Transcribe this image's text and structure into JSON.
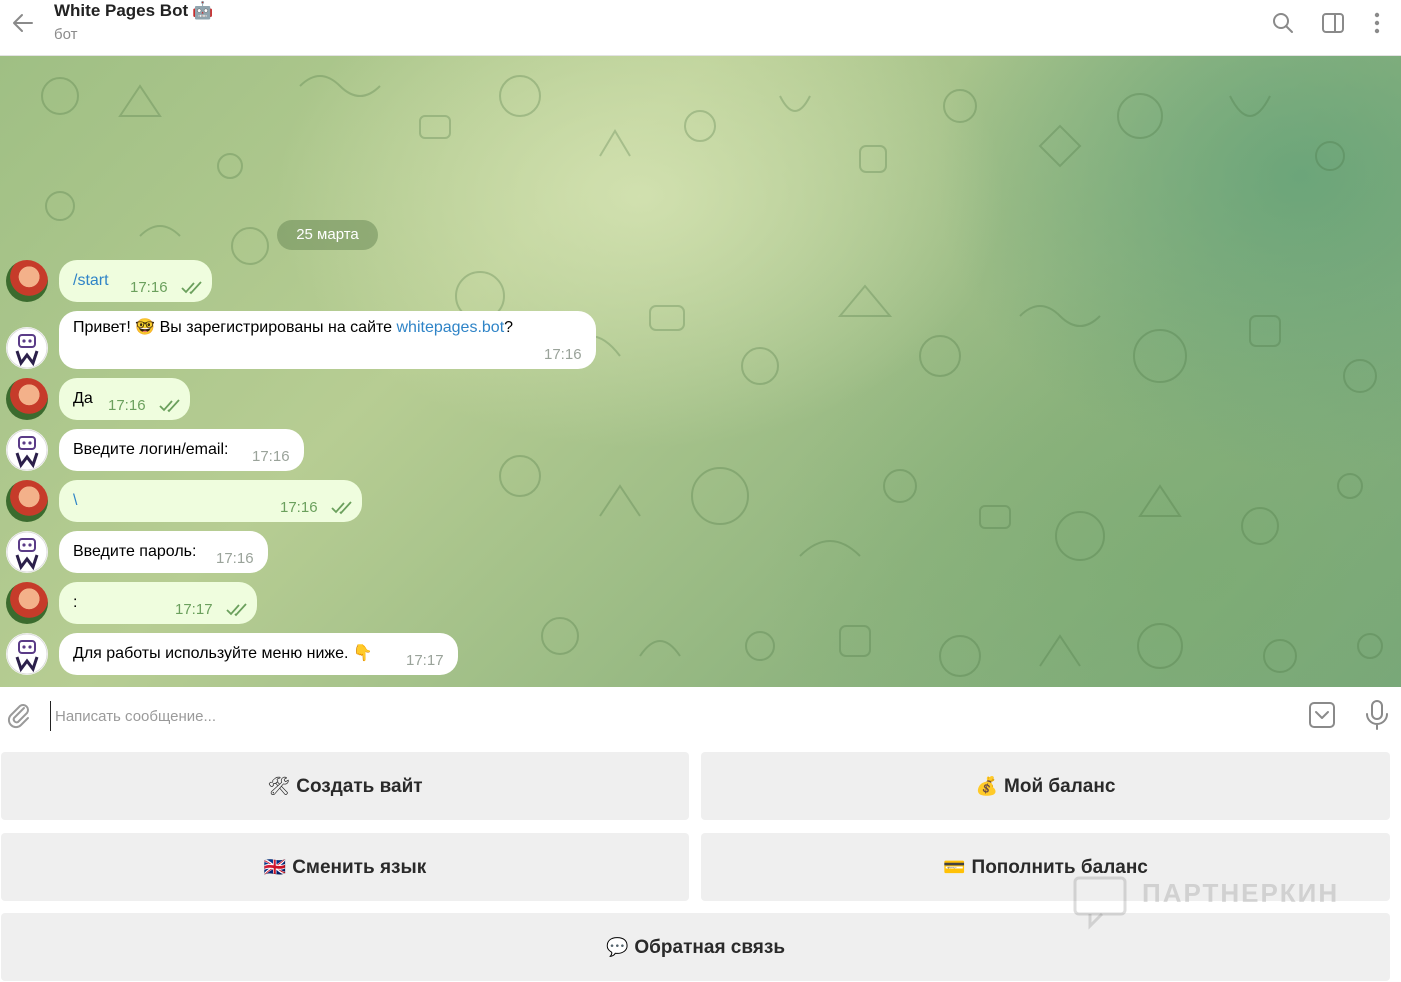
{
  "header": {
    "title": "White Pages Bot",
    "title_emoji": "🤖",
    "subtitle": "бот",
    "icons": [
      "back-arrow-icon",
      "search-icon",
      "sidebar-toggle-icon",
      "more-vertical-icon"
    ]
  },
  "chat": {
    "date": "25 марта",
    "messages": [
      {
        "from": "user",
        "text": "/start",
        "time": "17:16",
        "is_link": true
      },
      {
        "from": "bot",
        "text_before": "Привет! 🤓 Вы зарегистрированы на сайте ",
        "link": "whitepages.bot",
        "text_after": "?",
        "time": "17:16"
      },
      {
        "from": "user",
        "text": "Да",
        "time": "17:16"
      },
      {
        "from": "bot",
        "text": "Введите логин/email:",
        "time": "17:16"
      },
      {
        "from": "user",
        "text": "\\",
        "time": "17:16",
        "is_link": true
      },
      {
        "from": "bot",
        "text": "Введите пароль:",
        "time": "17:16"
      },
      {
        "from": "user",
        "text": ":",
        "time": "17:17"
      },
      {
        "from": "bot",
        "text": "Для работы используйте меню ниже. 👇",
        "time": "17:17"
      }
    ]
  },
  "composer": {
    "placeholder": "Написать сообщение..."
  },
  "keyboard": {
    "create_site": {
      "icon": "🛠",
      "label": "Создать вайт"
    },
    "my_balance": {
      "icon": "💰",
      "label": "Мой баланс"
    },
    "change_language": {
      "icon": "🇬🇧",
      "label": "Сменить язык"
    },
    "top_up_balance": {
      "icon": "💳",
      "label": "Пополнить баланс"
    },
    "feedback": {
      "icon": "💬",
      "label": "Обратная связь"
    }
  },
  "watermark": {
    "text": "ПАРТНЕРКИН"
  },
  "colors": {
    "outgoing_bubble": "#effdde",
    "incoming_bubble": "#ffffff",
    "link": "#2f84c7",
    "check_marks": "#6ba05d",
    "keyboard_button": "#efefef"
  }
}
